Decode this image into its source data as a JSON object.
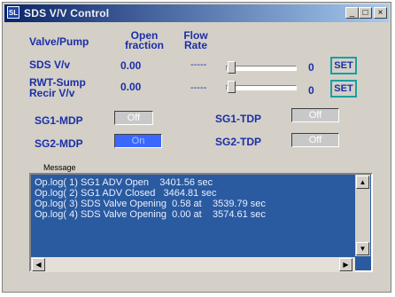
{
  "window": {
    "icon_text": "SL",
    "title": "SDS V/V Control",
    "btn_minimize": "_",
    "btn_maximize": "□",
    "btn_close": "×"
  },
  "headers": {
    "valve_pump": "Valve/Pump",
    "open_fraction": "Open\nfraction",
    "flow_rate": "Flow\nRate"
  },
  "rows": [
    {
      "label": "SDS V/v",
      "open_fraction": "0.00",
      "flow_rate": "-----",
      "slider_value": "0",
      "set_label": "SET"
    },
    {
      "label": "RWT-Sump\nRecir V/v",
      "open_fraction": "0.00",
      "flow_rate": "-----",
      "slider_value": "0",
      "set_label": "SET"
    }
  ],
  "pumps": {
    "sg1_mdp": {
      "label": "SG1-MDP",
      "state": "Off"
    },
    "sg2_mdp": {
      "label": "SG2-MDP",
      "state": "On"
    },
    "sg1_tdp": {
      "label": "SG1-TDP",
      "state": "Off"
    },
    "sg2_tdp": {
      "label": "SG2-TDP",
      "state": "Off"
    }
  },
  "message": {
    "label": "Message",
    "lines": [
      "Op.log( 1) SG1 ADV Open    3401.56 sec",
      "Op.log( 2) SG1 ADV Closed   3464.81 sec",
      "Op.log( 3) SDS Valve Opening  0.58 at    3539.79 sec",
      "Op.log( 4) SDS Valve Opening  0.00 at    3574.61 sec"
    ]
  },
  "colors": {
    "label_blue": "#1a2fa8",
    "message_bg": "#2a5aa0",
    "on_blue": "#3a68ff",
    "set_border": "#1a9fa0"
  }
}
